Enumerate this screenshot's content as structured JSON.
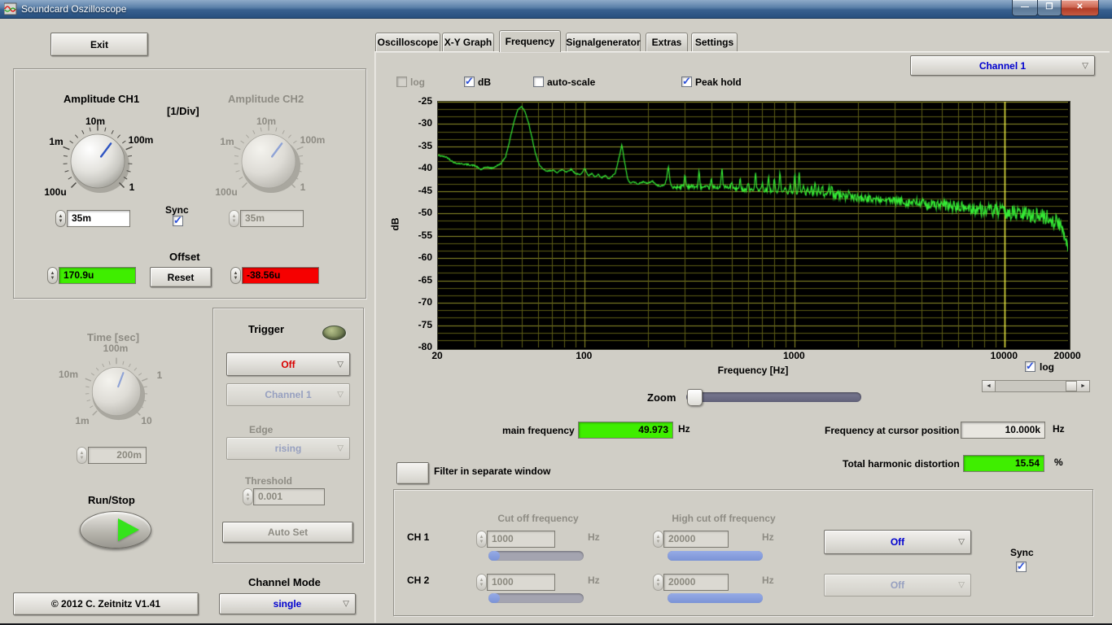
{
  "window": {
    "title": "Soundcard Oszilloscope"
  },
  "left": {
    "exit_label": "Exit",
    "amp": {
      "ch1_title": "Amplitude CH1",
      "unit": "[1/Div]",
      "ch2_title": "Amplitude CH2",
      "scale": [
        "100u",
        "1m",
        "10m",
        "100m",
        "1"
      ],
      "ch1_value": "35m",
      "ch2_value": "35m",
      "sync": "Sync",
      "sync_checked": true,
      "offset": {
        "title": "Offset",
        "ch1": "170.9u",
        "reset": "Reset",
        "ch2": "-38.56u"
      }
    },
    "time": {
      "title": "Time [sec]",
      "scale": [
        "1m",
        "10m",
        "100m",
        "1",
        "10"
      ],
      "value": "200m"
    },
    "run_stop": "Run/Stop",
    "copyright": "© 2012  C. Zeitnitz V1.41",
    "trigger": {
      "title": "Trigger",
      "mode": "Off",
      "source": "Channel 1",
      "edge_label": "Edge",
      "edge": "rising",
      "threshold_label": "Threshold",
      "threshold": "0.001",
      "auto_set": "Auto Set"
    },
    "channel_mode": {
      "label": "Channel Mode",
      "value": "single"
    }
  },
  "tabs": {
    "items": [
      "Oscilloscope",
      "X-Y Graph",
      "Frequency",
      "Signalgenerator",
      "Extras",
      "Settings"
    ],
    "active": "Frequency"
  },
  "freq": {
    "channel_select": "Channel 1",
    "log_cb": "log",
    "log_cb_checked": false,
    "db_cb": "dB",
    "db_cb_checked": true,
    "autoscale_cb": "auto-scale",
    "autoscale_cb_checked": false,
    "peakhold_cb": "Peak hold",
    "peakhold_cb_checked": true,
    "graph_log": "log",
    "graph_log_checked": true,
    "zoom_label": "Zoom",
    "main_freq_label": "main frequency",
    "main_freq_value": "49.973",
    "main_freq_unit": "Hz",
    "cursor_label": "Frequency at cursor position",
    "cursor_value": "10.000k",
    "cursor_unit": "Hz",
    "thd_label": "Total harmonic distortion",
    "thd_value": "15.54",
    "thd_unit": "%",
    "filter_window": "Filter in separate window",
    "filter": {
      "low_header": "Cut off frequency",
      "high_header": "High cut off frequency",
      "hz": "Hz",
      "sync": "Sync",
      "sync_checked": true,
      "ch1": {
        "name": "CH 1",
        "low": "1000",
        "high": "20000",
        "mode": "Off"
      },
      "ch2": {
        "name": "CH 2",
        "low": "1000",
        "high": "20000",
        "mode": "Off"
      }
    }
  },
  "chart_data": {
    "type": "line",
    "title": "Peak-hold frequency spectrum, Channel 1",
    "xlabel": "Frequency [Hz]",
    "ylabel": "dB",
    "x_scale": "log",
    "y_scale": "linear",
    "xlim": [
      20,
      20000
    ],
    "ylim": [
      -80,
      -25
    ],
    "x_ticks": [
      20,
      100,
      1000,
      10000,
      20000
    ],
    "y_ticks": [
      -25,
      -30,
      -35,
      -40,
      -45,
      -50,
      -55,
      -60,
      -65,
      -70,
      -75,
      -80
    ],
    "grid": true,
    "legend": false,
    "cursor_hz": 10000,
    "series_name": "Channel 1",
    "envelope_points": [
      [
        20,
        -37
      ],
      [
        22,
        -37.4
      ],
      [
        24,
        -38.7
      ],
      [
        26,
        -38.9
      ],
      [
        28,
        -39.1
      ],
      [
        30,
        -39.3
      ],
      [
        32,
        -40.2
      ],
      [
        34,
        -39.6
      ],
      [
        36,
        -39.9
      ],
      [
        38,
        -39.4
      ],
      [
        40,
        -38.8
      ],
      [
        42,
        -37.3
      ],
      [
        44,
        -33.5
      ],
      [
        46,
        -29.5
      ],
      [
        48,
        -26.8
      ],
      [
        50,
        -26
      ],
      [
        52,
        -27.2
      ],
      [
        54,
        -29.8
      ],
      [
        56,
        -33
      ],
      [
        58,
        -36.2
      ],
      [
        60,
        -38.6
      ],
      [
        63,
        -40.1
      ],
      [
        66,
        -40.6
      ],
      [
        70,
        -40.3
      ],
      [
        74,
        -40.8
      ],
      [
        78,
        -40.2
      ],
      [
        82,
        -40.7
      ],
      [
        86,
        -40.1
      ],
      [
        90,
        -41
      ],
      [
        95,
        -41.4
      ],
      [
        100,
        -39.9
      ],
      [
        104,
        -41.6
      ],
      [
        108,
        -41.1
      ],
      [
        112,
        -41.9
      ],
      [
        116,
        -41.3
      ],
      [
        120,
        -42.1
      ],
      [
        125,
        -41.5
      ],
      [
        130,
        -42.3
      ],
      [
        135,
        -41.7
      ],
      [
        140,
        -40.9
      ],
      [
        145,
        -37.9
      ],
      [
        150,
        -34.6
      ],
      [
        155,
        -38.6
      ],
      [
        160,
        -42.4
      ],
      [
        165,
        -43.2
      ],
      [
        170,
        -42.9
      ],
      [
        180,
        -43.4
      ],
      [
        190,
        -42.9
      ],
      [
        200,
        -43.3
      ],
      [
        210,
        -42.7
      ],
      [
        220,
        -43.7
      ],
      [
        230,
        -43.9
      ],
      [
        240,
        -43.6
      ],
      [
        245,
        -42.3
      ],
      [
        250,
        -39.3
      ],
      [
        255,
        -42.9
      ],
      [
        260,
        -44.2
      ]
    ],
    "noise_floor_points": [
      [
        260,
        -44.2
      ],
      [
        300,
        -43.9
      ],
      [
        350,
        -44.1
      ],
      [
        400,
        -44.3
      ],
      [
        450,
        -44.0
      ],
      [
        500,
        -44.4
      ],
      [
        600,
        -44.7
      ],
      [
        700,
        -44.9
      ],
      [
        800,
        -45.1
      ],
      [
        900,
        -45.2
      ],
      [
        1000,
        -45.4
      ],
      [
        1200,
        -45.7
      ],
      [
        1500,
        -46.0
      ],
      [
        2000,
        -46.5
      ],
      [
        2500,
        -46.9
      ],
      [
        3000,
        -47.2
      ],
      [
        4000,
        -47.8
      ],
      [
        5000,
        -48.2
      ],
      [
        6000,
        -48.6
      ],
      [
        7000,
        -48.9
      ],
      [
        8000,
        -49.2
      ],
      [
        10000,
        -49.7
      ],
      [
        12000,
        -50.1
      ],
      [
        14000,
        -50.4
      ],
      [
        16000,
        -51.0
      ],
      [
        17500,
        -51.8
      ],
      [
        18500,
        -53.0
      ],
      [
        19300,
        -54.8
      ],
      [
        19800,
        -56.3
      ],
      [
        20000,
        -57.5
      ]
    ],
    "harmonic_peaks": [
      [
        300,
        -41.4
      ],
      [
        350,
        -40.9
      ],
      [
        400,
        -42.4
      ],
      [
        450,
        -40.2
      ],
      [
        500,
        -42.9
      ],
      [
        550,
        -42.4
      ],
      [
        600,
        -43.0
      ],
      [
        650,
        -41.0
      ],
      [
        700,
        -43.4
      ],
      [
        750,
        -42.1
      ],
      [
        800,
        -42.4
      ],
      [
        850,
        -41.1
      ],
      [
        900,
        -43.9
      ],
      [
        950,
        -43.4
      ],
      [
        1000,
        -41.2
      ],
      [
        1050,
        -41.2
      ],
      [
        1100,
        -43.6
      ],
      [
        1150,
        -44.2
      ],
      [
        1200,
        -44.3
      ],
      [
        1250,
        -43.1
      ],
      [
        1300,
        -44.6
      ],
      [
        1350,
        -44.0
      ],
      [
        1400,
        -44.8
      ],
      [
        1450,
        -44.3
      ],
      [
        1500,
        -43.7
      ],
      [
        1600,
        -44.9
      ],
      [
        1700,
        -45.0
      ],
      [
        1800,
        -45.2
      ]
    ],
    "colors": {
      "bg": "#000000",
      "grid_minor": "#5c5c16",
      "grid_major": "#8f8f28",
      "cursor": "#eeee44",
      "trace": "#35e935"
    }
  }
}
